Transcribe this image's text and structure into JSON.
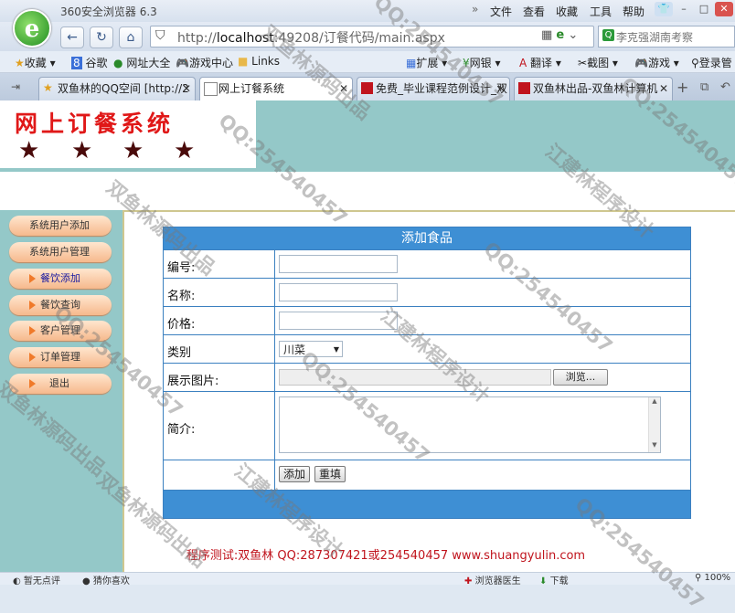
{
  "browser": {
    "app_name": "360安全浏览器 6.3",
    "menu": [
      "文件",
      "查看",
      "收藏",
      "工具",
      "帮助"
    ],
    "url_prefix": "http://",
    "url_host": "localhost",
    "url_rest": ":49208/订餐代码/main.aspx",
    "search_text": "李克强湖南考察",
    "bookmarks": [
      "收藏",
      "谷歌",
      "网址大全",
      "游戏中心",
      "Links"
    ],
    "toolbar_right": [
      "扩展",
      "网银",
      "翻译",
      "截图",
      "游戏",
      "登录管"
    ],
    "tabs": [
      {
        "title": "双鱼林的QQ空间 [http://2",
        "active": false
      },
      {
        "title": "网上订餐系统",
        "active": true
      },
      {
        "title": "免费_毕业课程范例设计_双",
        "active": false
      },
      {
        "title": "双鱼林出品-双鱼林计算机",
        "active": false
      }
    ],
    "status": [
      "暂无点评",
      "猜你喜欢",
      "浏览器医生",
      "下载",
      "100%"
    ]
  },
  "site": {
    "title": "网上订餐系统",
    "stars": [
      "★",
      "★",
      "★",
      "★"
    ],
    "sidebar": [
      "系统用户添加",
      "系统用户管理",
      "餐饮添加",
      "餐饮查询",
      "客户管理",
      "订单管理",
      "退出"
    ],
    "footer": "程序测试:双鱼林 QQ:287307421或254540457 www.shuangyulin.com"
  },
  "form": {
    "heading": "添加食品",
    "fields": {
      "id_label": "编号:",
      "id_value": "",
      "name_label": "名称:",
      "name_value": "",
      "price_label": "价格:",
      "price_value": "",
      "category_label": "类别",
      "category_value": "川菜",
      "image_label": "展示图片:",
      "browse_label": "浏览...",
      "intro_label": "简介:",
      "intro_value": ""
    },
    "submit_label": "添加",
    "reset_label": "重填"
  },
  "watermarks": [
    "QQ:254540457",
    "江建林程序设计",
    "双鱼林源码出品"
  ],
  "colors": {
    "banner": "#94c8c8",
    "form_header": "#3e8fd4",
    "title_red": "#e01818",
    "footer_red": "#c0141d"
  }
}
